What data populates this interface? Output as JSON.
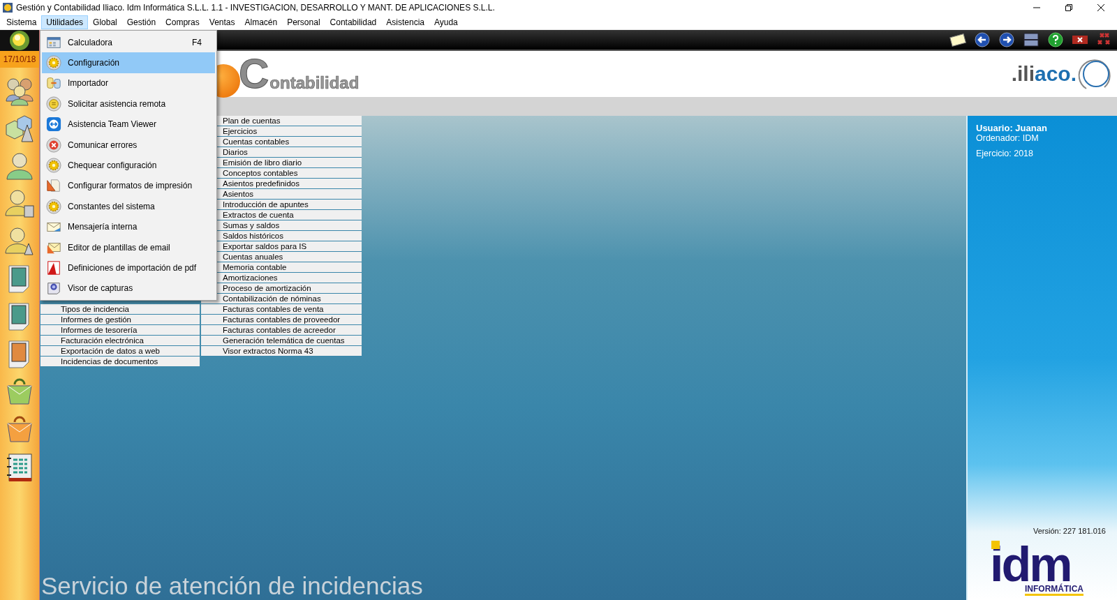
{
  "window": {
    "title": "Gestión y Contabilidad Iliaco. Idm Informática S.L.L. 1.1 - INVESTIGACION, DESARROLLO Y MANT. DE APLICACIONES S.L.L."
  },
  "menubar": [
    {
      "label": "Sistema",
      "selected": false
    },
    {
      "label": "Utilidades",
      "selected": true
    },
    {
      "label": "Global",
      "selected": false
    },
    {
      "label": "Gestión",
      "selected": false
    },
    {
      "label": "Compras",
      "selected": false
    },
    {
      "label": "Ventas",
      "selected": false
    },
    {
      "label": "Almacén",
      "selected": false
    },
    {
      "label": "Personal",
      "selected": false
    },
    {
      "label": "Contabilidad",
      "selected": false
    },
    {
      "label": "Asistencia",
      "selected": false
    },
    {
      "label": "Ayuda",
      "selected": false
    }
  ],
  "utilities_menu": [
    {
      "label": "Calculadora",
      "shortcut": "F4",
      "selected": false
    },
    {
      "label": "Configuración",
      "selected": true
    },
    {
      "label": "Importador",
      "selected": false
    },
    {
      "label": "Solicitar asistencia remota",
      "selected": false
    },
    {
      "label": "Asistencia Team Viewer",
      "selected": false
    },
    {
      "label": "Comunicar errores",
      "selected": false
    },
    {
      "label": "Chequear configuración",
      "selected": false
    },
    {
      "label": "Configurar formatos de impresión",
      "selected": false
    },
    {
      "label": "Constantes del sistema",
      "selected": false
    },
    {
      "label": "Mensajería interna",
      "selected": false
    },
    {
      "label": "Editor de plantillas de email",
      "selected": false
    },
    {
      "label": "Definiciones de importación de pdf",
      "selected": false
    },
    {
      "label": "Visor de capturas",
      "selected": false
    }
  ],
  "sidebar": {
    "date": "17/10/18"
  },
  "header": {
    "module_logo": {
      "initial": "C",
      "rest": "ontabilidad"
    },
    "brand_logo": {
      "part_1": ".ili",
      "part_2": "aco."
    }
  },
  "column_1": [
    "Tipos de incidencia",
    "Informes de gestión",
    "Informes de tesorería",
    "Facturación electrónica",
    "Exportación de datos a web",
    "Incidencias de documentos"
  ],
  "column_2": [
    "Plan de cuentas",
    "Ejercicios",
    "Cuentas contables",
    "Diarios",
    "Emisión de libro diario",
    "Conceptos contables",
    "Asientos predefinidos",
    "Asientos",
    "Introducción de apuntes",
    "Extractos de cuenta",
    "Sumas y saldos",
    "Saldos históricos",
    "Exportar saldos para IS",
    "Cuentas anuales",
    "Memoria contable",
    "Amortizaciones",
    "Proceso de amortización",
    "Contabilización de nóminas",
    "Facturas contables de venta",
    "Facturas contables de proveedor",
    "Facturas contables de acreedor",
    "Generación telemática de cuentas",
    "Visor extractos Norma 43"
  ],
  "info_panel": {
    "user": "Usuario: Juanan",
    "computer": "Ordenador: IDM",
    "fiscal_year": "Ejercicio: 2018",
    "version": "Versión: 227 181.016",
    "company_logo": {
      "main": "idm",
      "sub": "INFORMÁTICA"
    }
  },
  "banner": "Servicio de atención de incidencias"
}
